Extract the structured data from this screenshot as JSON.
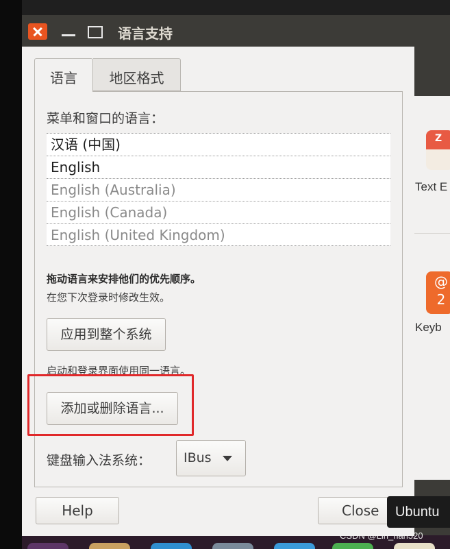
{
  "window": {
    "title": "语言支持",
    "tabs": [
      {
        "label": "语言",
        "active": true
      },
      {
        "label": "地区格式",
        "active": false
      }
    ]
  },
  "language_tab": {
    "menu_language_label": "菜单和窗口的语言：",
    "languages": [
      {
        "label": "汉语 (中国)",
        "enabled": true
      },
      {
        "label": "English",
        "enabled": true
      },
      {
        "label": "English (Australia)",
        "enabled": false
      },
      {
        "label": "English (Canada)",
        "enabled": false
      },
      {
        "label": "English (United Kingdom)",
        "enabled": false
      }
    ],
    "drag_hint": "拖动语言来安排他们的优先顺序。",
    "effect_hint": "在您下次登录时修改生效。",
    "apply_button": "应用到整个系统",
    "login_hint": "启动和登录界面使用同一语言。",
    "add_remove_button": "添加或删除语言...",
    "keyboard_input_label": "键盘输入法系统：",
    "keyboard_input_value": "IBus"
  },
  "footer": {
    "help_button": "Help",
    "close_button": "Close"
  },
  "background": {
    "icon_labels": [
      "Text E",
      "Keyb"
    ],
    "icon_glyphs": [
      "Z",
      "@\n2"
    ]
  },
  "tooltip": "Ubuntu",
  "watermark": "CSDN @Lin_han520",
  "colors": {
    "titlebar": "#3c3b37",
    "close_button": "#e95420",
    "highlight_box": "#e0282a",
    "dialog_bg": "#f2f1f0"
  }
}
